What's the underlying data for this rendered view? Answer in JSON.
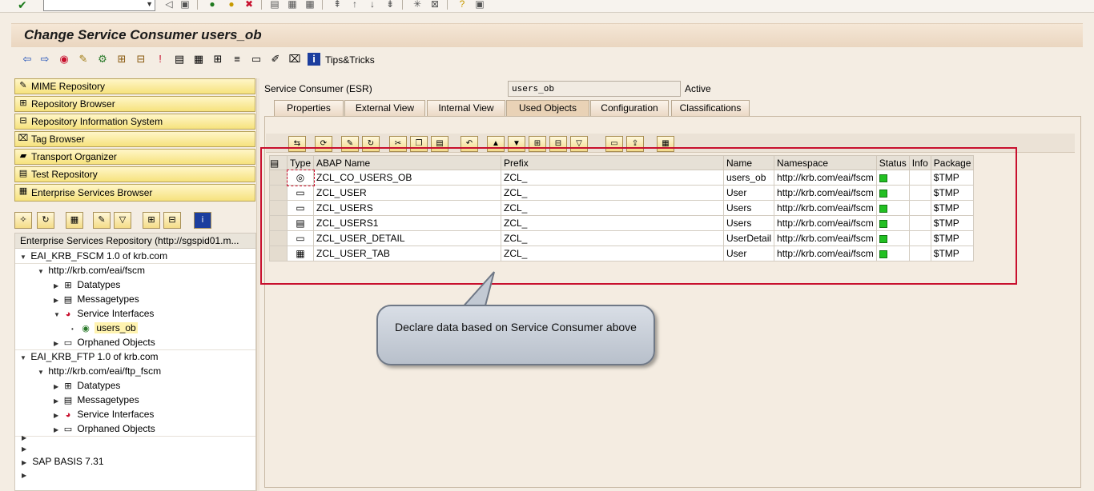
{
  "window": {
    "title": "Change Service Consumer users_ob"
  },
  "app_toolbar": {
    "tips_label": "Tips&Tricks"
  },
  "nav": {
    "items": [
      "MIME Repository",
      "Repository Browser",
      "Repository Information System",
      "Tag Browser",
      "Transport Organizer",
      "Test Repository",
      "Enterprise Services Browser"
    ]
  },
  "tree": {
    "header": "Enterprise Services Repository (http://sgspid01.m...",
    "rows": [
      "EAI_KRB_FSCM 1.0 of krb.com",
      "http://krb.com/eai/fscm",
      "Datatypes",
      "Messagetypes",
      "Service Interfaces",
      "users_ob",
      "Orphaned Objects",
      "EAI_KRB_FTP 1.0 of krb.com",
      "http://krb.com/eai/ftp_fscm",
      "Datatypes",
      "Messagetypes",
      "Service Interfaces",
      "Orphaned Objects",
      "SAP BASIS 7.31"
    ]
  },
  "detail": {
    "label": "Service Consumer (ESR)",
    "value": "users_ob",
    "status": "Active"
  },
  "tabs": [
    "Properties",
    "External View",
    "Internal View",
    "Used Objects",
    "Configuration",
    "Classifications"
  ],
  "table": {
    "headers": [
      "Type",
      "ABAP Name",
      "Prefix",
      "Name",
      "Namespace",
      "Status",
      "Info",
      "Package"
    ],
    "rows": [
      {
        "abap": "ZCL_CO_USERS_OB",
        "prefix": "ZCL_",
        "name": "users_ob",
        "ns": "http://krb.com/eai/fscm",
        "pkg": "$TMP",
        "icon": "consumer-icon"
      },
      {
        "abap": "ZCL_USER",
        "prefix": "ZCL_",
        "name": "User",
        "ns": "http://krb.com/eai/fscm",
        "pkg": "$TMP",
        "icon": "structure-icon"
      },
      {
        "abap": "ZCL_USERS",
        "prefix": "ZCL_",
        "name": "Users",
        "ns": "http://krb.com/eai/fscm",
        "pkg": "$TMP",
        "icon": "structure-icon"
      },
      {
        "abap": "ZCL_USERS1",
        "prefix": "ZCL_",
        "name": "Users",
        "ns": "http://krb.com/eai/fscm",
        "pkg": "$TMP",
        "icon": "message-icon"
      },
      {
        "abap": "ZCL_USER_DETAIL",
        "prefix": "ZCL_",
        "name": "UserDetail",
        "ns": "http://krb.com/eai/fscm",
        "pkg": "$TMP",
        "icon": "structure-icon"
      },
      {
        "abap": "ZCL_USER_TAB",
        "prefix": "ZCL_",
        "name": "User",
        "ns": "http://krb.com/eai/fscm",
        "pkg": "$TMP",
        "icon": "table-type-icon"
      }
    ]
  },
  "callout": {
    "text": "Declare data based on Service Consumer above"
  },
  "colors": {
    "status_green": "#22c022",
    "highlight_red": "#c8102e",
    "nav_button": "#f6e27e"
  }
}
